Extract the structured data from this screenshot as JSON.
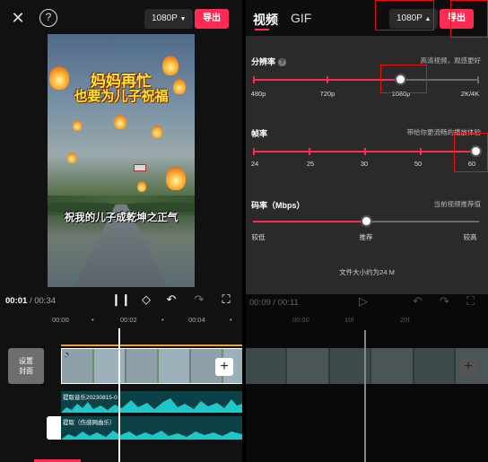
{
  "left": {
    "resolution_button": "1080P",
    "export_button": "导出",
    "video": {
      "title_line1": "妈妈再忙",
      "title_line2": "也要为儿子祝福",
      "subtitle": "祝我的儿子成乾坤之正气"
    },
    "playback": {
      "current": "00:01",
      "total": "/ 00:34"
    },
    "ruler": [
      "00:00",
      "00:02",
      "00:04"
    ],
    "cover_label_line1": "设置",
    "cover_label_line2": "封面",
    "audio_tracks": [
      {
        "label": "提取音乐20230815-0"
      },
      {
        "label": "提取（伤感网曲乐）"
      }
    ]
  },
  "right": {
    "tabs": [
      {
        "label": "视频"
      },
      {
        "label": "GIF"
      }
    ],
    "resolution_button": "1080P",
    "export_button": "导出",
    "resolution": {
      "title": "分辨率",
      "help_icon": "?",
      "hint": "高清视频，观感更好",
      "labels": [
        "480p",
        "720p",
        "1080p",
        "2K/4K"
      ],
      "selected": "1080p"
    },
    "framerate": {
      "title": "帧率",
      "hint": "带给你更流畅的播放体验",
      "labels": [
        "24",
        "25",
        "30",
        "50",
        "60"
      ],
      "selected": "60"
    },
    "bitrate": {
      "title": "码率（Mbps）",
      "hint": "当前视频推荐值",
      "labels": [
        "较低",
        "推荐",
        "较高"
      ],
      "selected": "推荐"
    },
    "file_size": "文件大小约为24 M",
    "playback": {
      "current": "00:09",
      "total": "/ 00:11"
    },
    "ruler": [
      "00:00",
      "10f",
      "20f"
    ]
  },
  "colors": {
    "accent": "#fe2c55",
    "highlight": "#e41212",
    "audio_bg": "#0c4148",
    "waveform": "#1ec8c8"
  },
  "icons": [
    "close-icon",
    "help-icon",
    "chevron-down-icon",
    "play-pause-icon",
    "keyframe-icon",
    "undo-icon",
    "redo-icon",
    "fullscreen-icon",
    "play-icon",
    "plus-icon",
    "volume-icon"
  ]
}
